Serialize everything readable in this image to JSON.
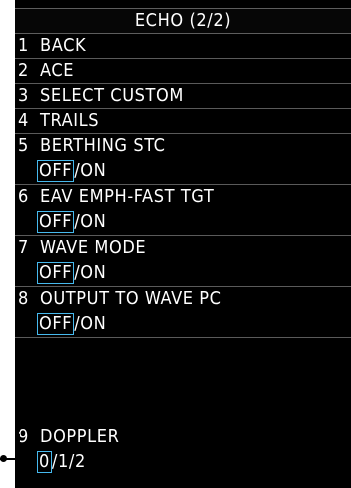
{
  "menu": {
    "title": "ECHO (2/2)",
    "items": [
      {
        "num": "1",
        "label": "BACK"
      },
      {
        "num": "2",
        "label": "ACE"
      },
      {
        "num": "3",
        "label": "SELECT CUSTOM"
      },
      {
        "num": "4",
        "label": "TRAILS"
      },
      {
        "num": "5",
        "label": "BERTHING STC",
        "options": [
          "OFF",
          "ON"
        ],
        "selected": "OFF"
      },
      {
        "num": "6",
        "label": "EAV EMPH-FAST TGT",
        "options": [
          "OFF",
          "ON"
        ],
        "selected": "OFF"
      },
      {
        "num": "7",
        "label": "WAVE MODE",
        "options": [
          "OFF",
          "ON"
        ],
        "selected": "OFF"
      },
      {
        "num": "8",
        "label": "OUTPUT TO WAVE PC",
        "options": [
          "OFF",
          "ON"
        ],
        "selected": "OFF"
      },
      {
        "num": "9",
        "label": "DOPPLER",
        "options": [
          "0",
          "1",
          "2"
        ],
        "selected": "0"
      }
    ],
    "option_separator": "/"
  },
  "colors": {
    "background": "#000000",
    "text": "#ffffff",
    "selection_box": "#46b9ee",
    "row_divider": "#5a5a5a"
  }
}
